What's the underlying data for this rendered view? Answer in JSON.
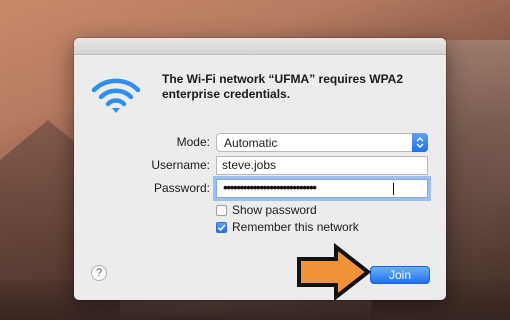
{
  "dialog": {
    "message": "The Wi-Fi network “UFMA” requires WPA2 enterprise credentials.",
    "mode_label": "Mode:",
    "mode_value": "Automatic",
    "username_label": "Username:",
    "username_value": "steve.jobs",
    "password_label": "Password:",
    "password_dots": "••••••••••••••••••••••••••••",
    "show_password_label": "Show password",
    "show_password_checked": false,
    "remember_label": "Remember this network",
    "remember_checked": true,
    "help_label": "?",
    "join_label": "Join"
  },
  "colors": {
    "accent": "#1d72f1",
    "arrow_fill": "#f0923a",
    "wifi": "#2f8ef2"
  },
  "icons": {
    "wifi": "wifi-icon",
    "mode_stepper": "chevron-updown-icon",
    "check": "checkmark-icon",
    "arrow": "arrow-right-icon"
  }
}
